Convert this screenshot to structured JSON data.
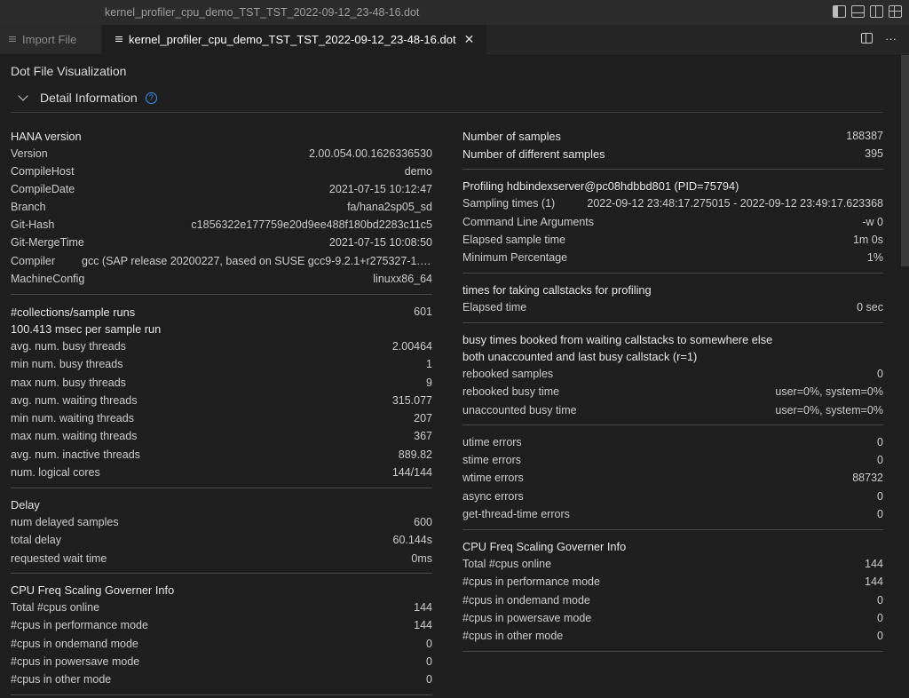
{
  "window": {
    "title": "kernel_profiler_cpu_demo_TST_TST_2022-09-12_23-48-16.dot"
  },
  "tabs": [
    {
      "label": "Import File"
    },
    {
      "label": "kernel_profiler_cpu_demo_TST_TST_2022-09-12_23-48-16.dot",
      "close": "✕"
    }
  ],
  "tab_actions": {
    "more": "···"
  },
  "page": {
    "title": "Dot File Visualization",
    "section": "Detail Information",
    "help": "?"
  },
  "left": {
    "hana_header": "HANA version",
    "hana": [
      {
        "k": "Version",
        "v": "2.00.054.00.1626336530"
      },
      {
        "k": "CompileHost",
        "v": "demo"
      },
      {
        "k": "CompileDate",
        "v": "2021-07-15 10:12:47"
      },
      {
        "k": "Branch",
        "v": "fa/hana2sp05_sd"
      },
      {
        "k": "Git-Hash",
        "v": "c1856322e177759e20d9ee488f180bd2283c11c5"
      },
      {
        "k": "Git-MergeTime",
        "v": "2021-07-15 10:08:50"
      },
      {
        "k": "Compiler",
        "v": "gcc (SAP release 20200227, based on SUSE gcc9-9.2.1+r275327-1.3.7..."
      },
      {
        "k": "MachineConfig",
        "v": "linuxx86_64"
      }
    ],
    "collections": {
      "k": "#collections/sample runs",
      "v": "601"
    },
    "msec": "100.413 msec per sample run",
    "threads": [
      {
        "k": "avg. num. busy threads",
        "v": "2.00464"
      },
      {
        "k": "min num. busy threads",
        "v": "1"
      },
      {
        "k": "max num. busy threads",
        "v": "9"
      },
      {
        "k": "avg. num. waiting threads",
        "v": "315.077"
      },
      {
        "k": "min num. waiting threads",
        "v": "207"
      },
      {
        "k": "max num. waiting threads",
        "v": "367"
      },
      {
        "k": "avg. num. inactive threads",
        "v": "889.82"
      },
      {
        "k": "num. logical cores",
        "v": "144/144"
      }
    ],
    "delay_header": "Delay",
    "delay": [
      {
        "k": "num delayed samples",
        "v": "600"
      },
      {
        "k": "total delay",
        "v": "60.144s"
      },
      {
        "k": "requested wait time",
        "v": "0ms"
      }
    ],
    "cpu_header": "CPU Freq Scaling Governer Info",
    "cpu": [
      {
        "k": "Total #cpus online",
        "v": "144"
      },
      {
        "k": "#cpus in performance mode",
        "v": "144"
      },
      {
        "k": "#cpus in ondemand mode",
        "v": "0"
      },
      {
        "k": "#cpus in powersave mode",
        "v": "0"
      },
      {
        "k": "#cpus in other mode",
        "v": "0"
      }
    ]
  },
  "right": {
    "samples": [
      {
        "k": "Number of samples",
        "v": "188387"
      },
      {
        "k": "Number of different samples",
        "v": "395"
      }
    ],
    "profiling_header": "Profiling hdbindexserver@pc08hdbbd801 (PID=75794)",
    "profiling": [
      {
        "k": "Sampling times (1)",
        "v": "2022-09-12 23:48:17.275015 - 2022-09-12 23:49:17.623368"
      },
      {
        "k": "Command Line Arguments",
        "v": "-w 0"
      },
      {
        "k": "Elapsed sample time",
        "v": "1m 0s"
      },
      {
        "k": "Minimum Percentage",
        "v": "1%"
      }
    ],
    "callstacks_header": "times for taking callstacks for profiling",
    "callstacks": [
      {
        "k": "Elapsed time",
        "v": "0 sec"
      }
    ],
    "busy_header_1": "busy times booked from waiting callstacks to somewhere else",
    "busy_header_2": "both unaccounted and last busy callstack (r=1)",
    "busy": [
      {
        "k": "rebooked samples",
        "v": "0"
      },
      {
        "k": "rebooked busy time",
        "v": "user=0%, system=0%"
      },
      {
        "k": "unaccounted busy time",
        "v": "user=0%, system=0%"
      }
    ],
    "errors": [
      {
        "k": "utime errors",
        "v": "0"
      },
      {
        "k": "stime errors",
        "v": "0"
      },
      {
        "k": "wtime errors",
        "v": "88732"
      },
      {
        "k": "async errors",
        "v": "0"
      },
      {
        "k": "get-thread-time errors",
        "v": "0"
      }
    ],
    "cpu_header": "CPU Freq Scaling Governer Info",
    "cpu": [
      {
        "k": "Total #cpus online",
        "v": "144"
      },
      {
        "k": "#cpus in performance mode",
        "v": "144"
      },
      {
        "k": "#cpus in ondemand mode",
        "v": "0"
      },
      {
        "k": "#cpus in powersave mode",
        "v": "0"
      },
      {
        "k": "#cpus in other mode",
        "v": "0"
      }
    ]
  }
}
